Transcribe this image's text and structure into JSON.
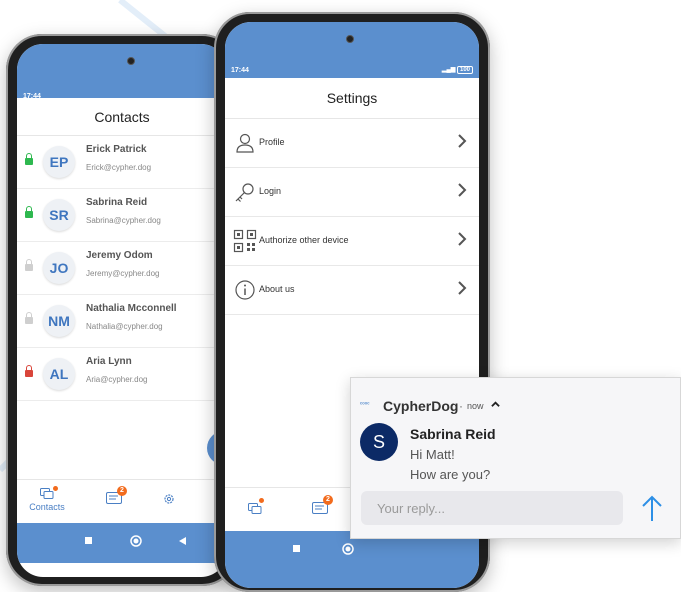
{
  "colors": {
    "brand_blue": "#5b8fce",
    "link_blue": "#4a7fc4",
    "badge_orange": "#f26b1d",
    "lock_green": "#2eb84f",
    "lock_gray": "#cfcfcf",
    "lock_red": "#d9453a",
    "notification_avatar": "#0c2a66",
    "send_arrow": "#2d8fe6"
  },
  "contacts_screen": {
    "status_time": "17:44",
    "title": "Contacts",
    "contacts": [
      {
        "initials": "EP",
        "name": "Erick Patrick",
        "email": "Erick@cypher.dog",
        "lock": "green"
      },
      {
        "initials": "SR",
        "name": "Sabrina Reid",
        "email": "Sabrina@cypher.dog",
        "lock": "green"
      },
      {
        "initials": "JO",
        "name": "Jeremy Odom",
        "email": "Jeremy@cypher.dog",
        "lock": "gray"
      },
      {
        "initials": "NM",
        "name": "Nathalia Mcconnell",
        "email": "Nathalia@cypher.dog",
        "lock": "gray"
      },
      {
        "initials": "AL",
        "name": "Aria Lynn",
        "email": "Aria@cypher.dog",
        "lock": "red"
      }
    ],
    "bottom_nav": {
      "contacts_label": "Contacts",
      "contacts_icon": "contacts-chat-icon",
      "chats_icon": "chats-icon",
      "chats_badge": "2",
      "settings_icon": "gear-icon"
    },
    "system_nav": [
      "square-icon",
      "circle-icon",
      "back-triangle-icon"
    ]
  },
  "settings_screen": {
    "status_time": "17:44",
    "status_icons": "ᵈᴵıl 100",
    "title": "Settings",
    "items": [
      {
        "label": "Profile",
        "icon": "person-icon"
      },
      {
        "label": "Login",
        "icon": "key-icon"
      },
      {
        "label": "Authorize other device",
        "icon": "qr-code-icon"
      },
      {
        "label": "About us",
        "icon": "info-icon"
      }
    ],
    "bottom_nav": {
      "chats_badge": "2"
    }
  },
  "notification": {
    "app_icon_text": "ᶜᵒᵒᶜ",
    "app_name": "CypherDog",
    "separator": "·",
    "time": "now",
    "avatar_letter": "S",
    "sender": "Sabrina Reid",
    "message_lines": [
      "Hi Matt!",
      "How are you?"
    ],
    "reply_placeholder": "Your reply...",
    "send_icon": "up-arrow-icon"
  }
}
